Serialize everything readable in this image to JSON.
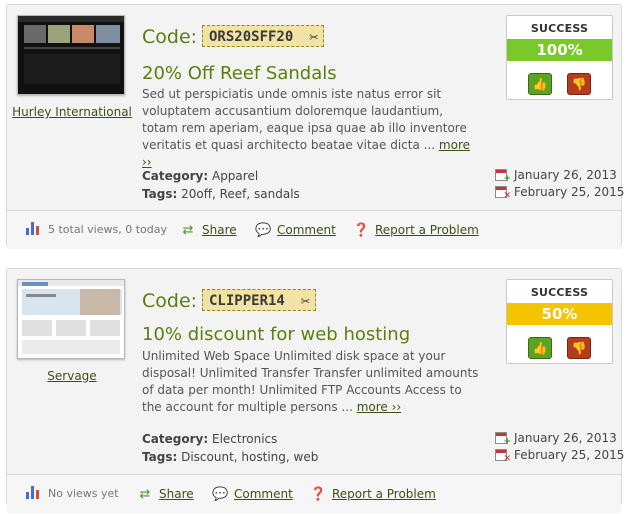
{
  "coupons": [
    {
      "store": "Hurley International",
      "code_label": "Code:",
      "code": "ORS20SFF20",
      "title": "20% Off Reef Sandals",
      "description": "Sed ut perspiciatis unde omnis iste natus error sit voluptatem accusantium doloremque laudantium, totam rem aperiam, eaque ipsa quae ab illo inventore veritatis et quasi architecto beatae vitae dicta ...",
      "more": "more ››",
      "category_label": "Category:",
      "category": "Apparel",
      "tags_label": "Tags:",
      "tags": "20off, Reef, sandals",
      "success_label": "SUCCESS",
      "success_percent": "100%",
      "success_color": "#7ac92a",
      "start_date": "January 26, 2013",
      "end_date": "February 25, 2015",
      "views": "5 total views, 0 today",
      "share": "Share",
      "comment": "Comment",
      "report": "Report a Problem"
    },
    {
      "store": "Servage",
      "code_label": "Code:",
      "code": "CLIPPER14",
      "title": "10% discount for web hosting",
      "description": "Unlimited Web Space Unlimited disk space at your disposal! Unlimited Transfer Transfer unlimited amounts of data per month! Unlimited FTP Accounts Access to the account for multiple persons ...",
      "more": "more ››",
      "category_label": "Category:",
      "category": "Electronics",
      "tags_label": "Tags:",
      "tags": "Discount, hosting, web",
      "success_label": "SUCCESS",
      "success_percent": "50%",
      "success_color": "#f5c400",
      "start_date": "January 26, 2013",
      "end_date": "February 25, 2015",
      "views": "No views yet",
      "share": "Share",
      "comment": "Comment",
      "report": "Report a Problem"
    }
  ],
  "icons": {
    "scissors": "scissors-icon",
    "thumbs_up": "thumbs-up-icon",
    "thumbs_down": "thumbs-down-icon",
    "calendar_add": "calendar-add-icon",
    "calendar_remove": "calendar-remove-icon",
    "stats": "bar-chart-icon",
    "share": "share-arrows-icon",
    "comment": "speech-bubble-icon",
    "report": "help-circle-icon"
  }
}
